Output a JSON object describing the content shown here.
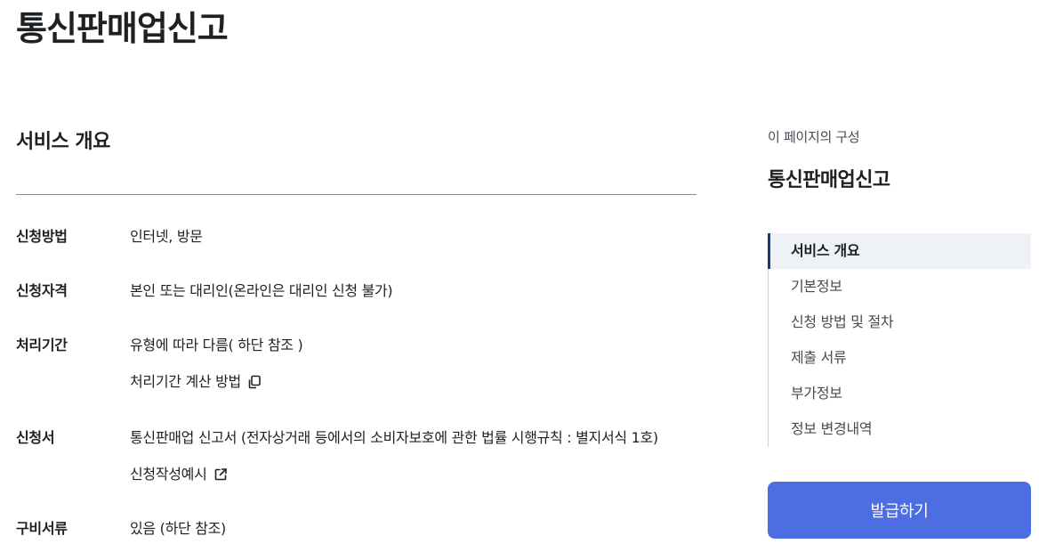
{
  "page": {
    "title": "통신판매업신고"
  },
  "overview": {
    "section_title": "서비스 개요",
    "rows": [
      {
        "label": "신청방법",
        "value": "인터넷, 방문"
      },
      {
        "label": "신청자격",
        "value": "본인 또는 대리인(온라인은 대리인 신청 불가)"
      },
      {
        "label": "처리기간",
        "value": "유형에 따라 다름( 하단 참조 )",
        "link": "처리기간 계산 방법",
        "link_icon": "copy-icon"
      },
      {
        "label": "신청서",
        "value": "통신판매업 신고서 (전자상거래 등에서의 소비자보호에 관한 법률 시행규칙 : 별지서식 1호)",
        "link": "신청작성예시",
        "link_icon": "external-link-icon"
      },
      {
        "label": "구비서류",
        "value": "있음 (하단 참조)"
      }
    ]
  },
  "toc": {
    "caption": "이 페이지의 구성",
    "title": "통신판매업신고",
    "items": [
      {
        "label": "서비스 개요",
        "active": true
      },
      {
        "label": "기본정보",
        "active": false
      },
      {
        "label": "신청 방법 및 절차",
        "active": false
      },
      {
        "label": "제출 서류",
        "active": false
      },
      {
        "label": "부가정보",
        "active": false
      },
      {
        "label": "정보 변경내역",
        "active": false
      }
    ]
  },
  "actions": {
    "issue_label": "발급하기"
  },
  "colors": {
    "primary_button": "#4c6ee2",
    "active_indicator": "#1c3a72",
    "active_background": "#eef2f7"
  }
}
